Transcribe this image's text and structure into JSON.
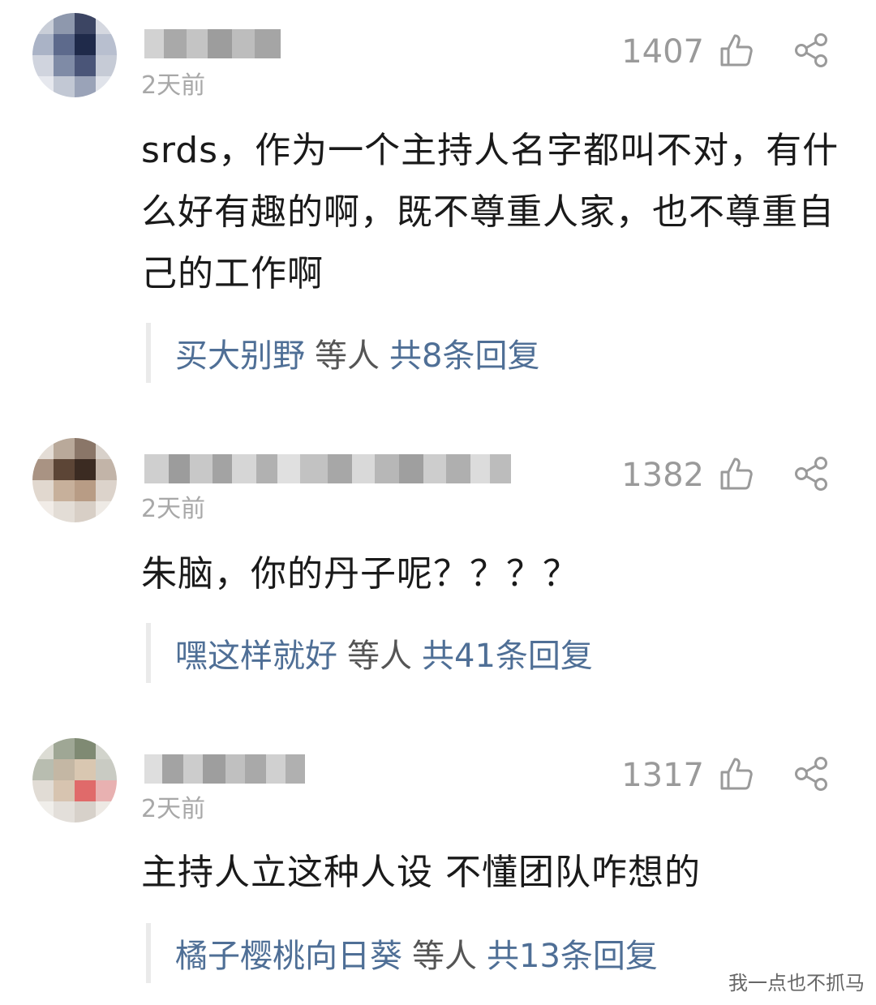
{
  "comments": [
    {
      "time": "2天前",
      "likes": "1407",
      "content": "srds，作为一个主持人名字都叫不对，有什么好有趣的啊，既不尊重人家，也不尊重自己的工作啊",
      "reply": {
        "names": "买大别野",
        "mid": "等人",
        "count": "共8条回复"
      }
    },
    {
      "time": "2天前",
      "likes": "1382",
      "content": "朱脑，你的丹子呢？？？？",
      "reply": {
        "names": "嘿这样就好",
        "mid": "等人",
        "count": "共41条回复"
      }
    },
    {
      "time": "2天前",
      "likes": "1317",
      "content": "主持人立这种人设 不懂团队咋想的",
      "reply": {
        "names": "橘子樱桃向日葵",
        "mid": "等人",
        "count": "共13条回复"
      }
    }
  ],
  "icons": {
    "like": "thumbs-up-icon",
    "share": "share-icon"
  },
  "colors": {
    "link": "#4f6f96",
    "muted": "#a8a8a8",
    "text": "#1a1a1a"
  },
  "watermark": "我一点也不抓马"
}
